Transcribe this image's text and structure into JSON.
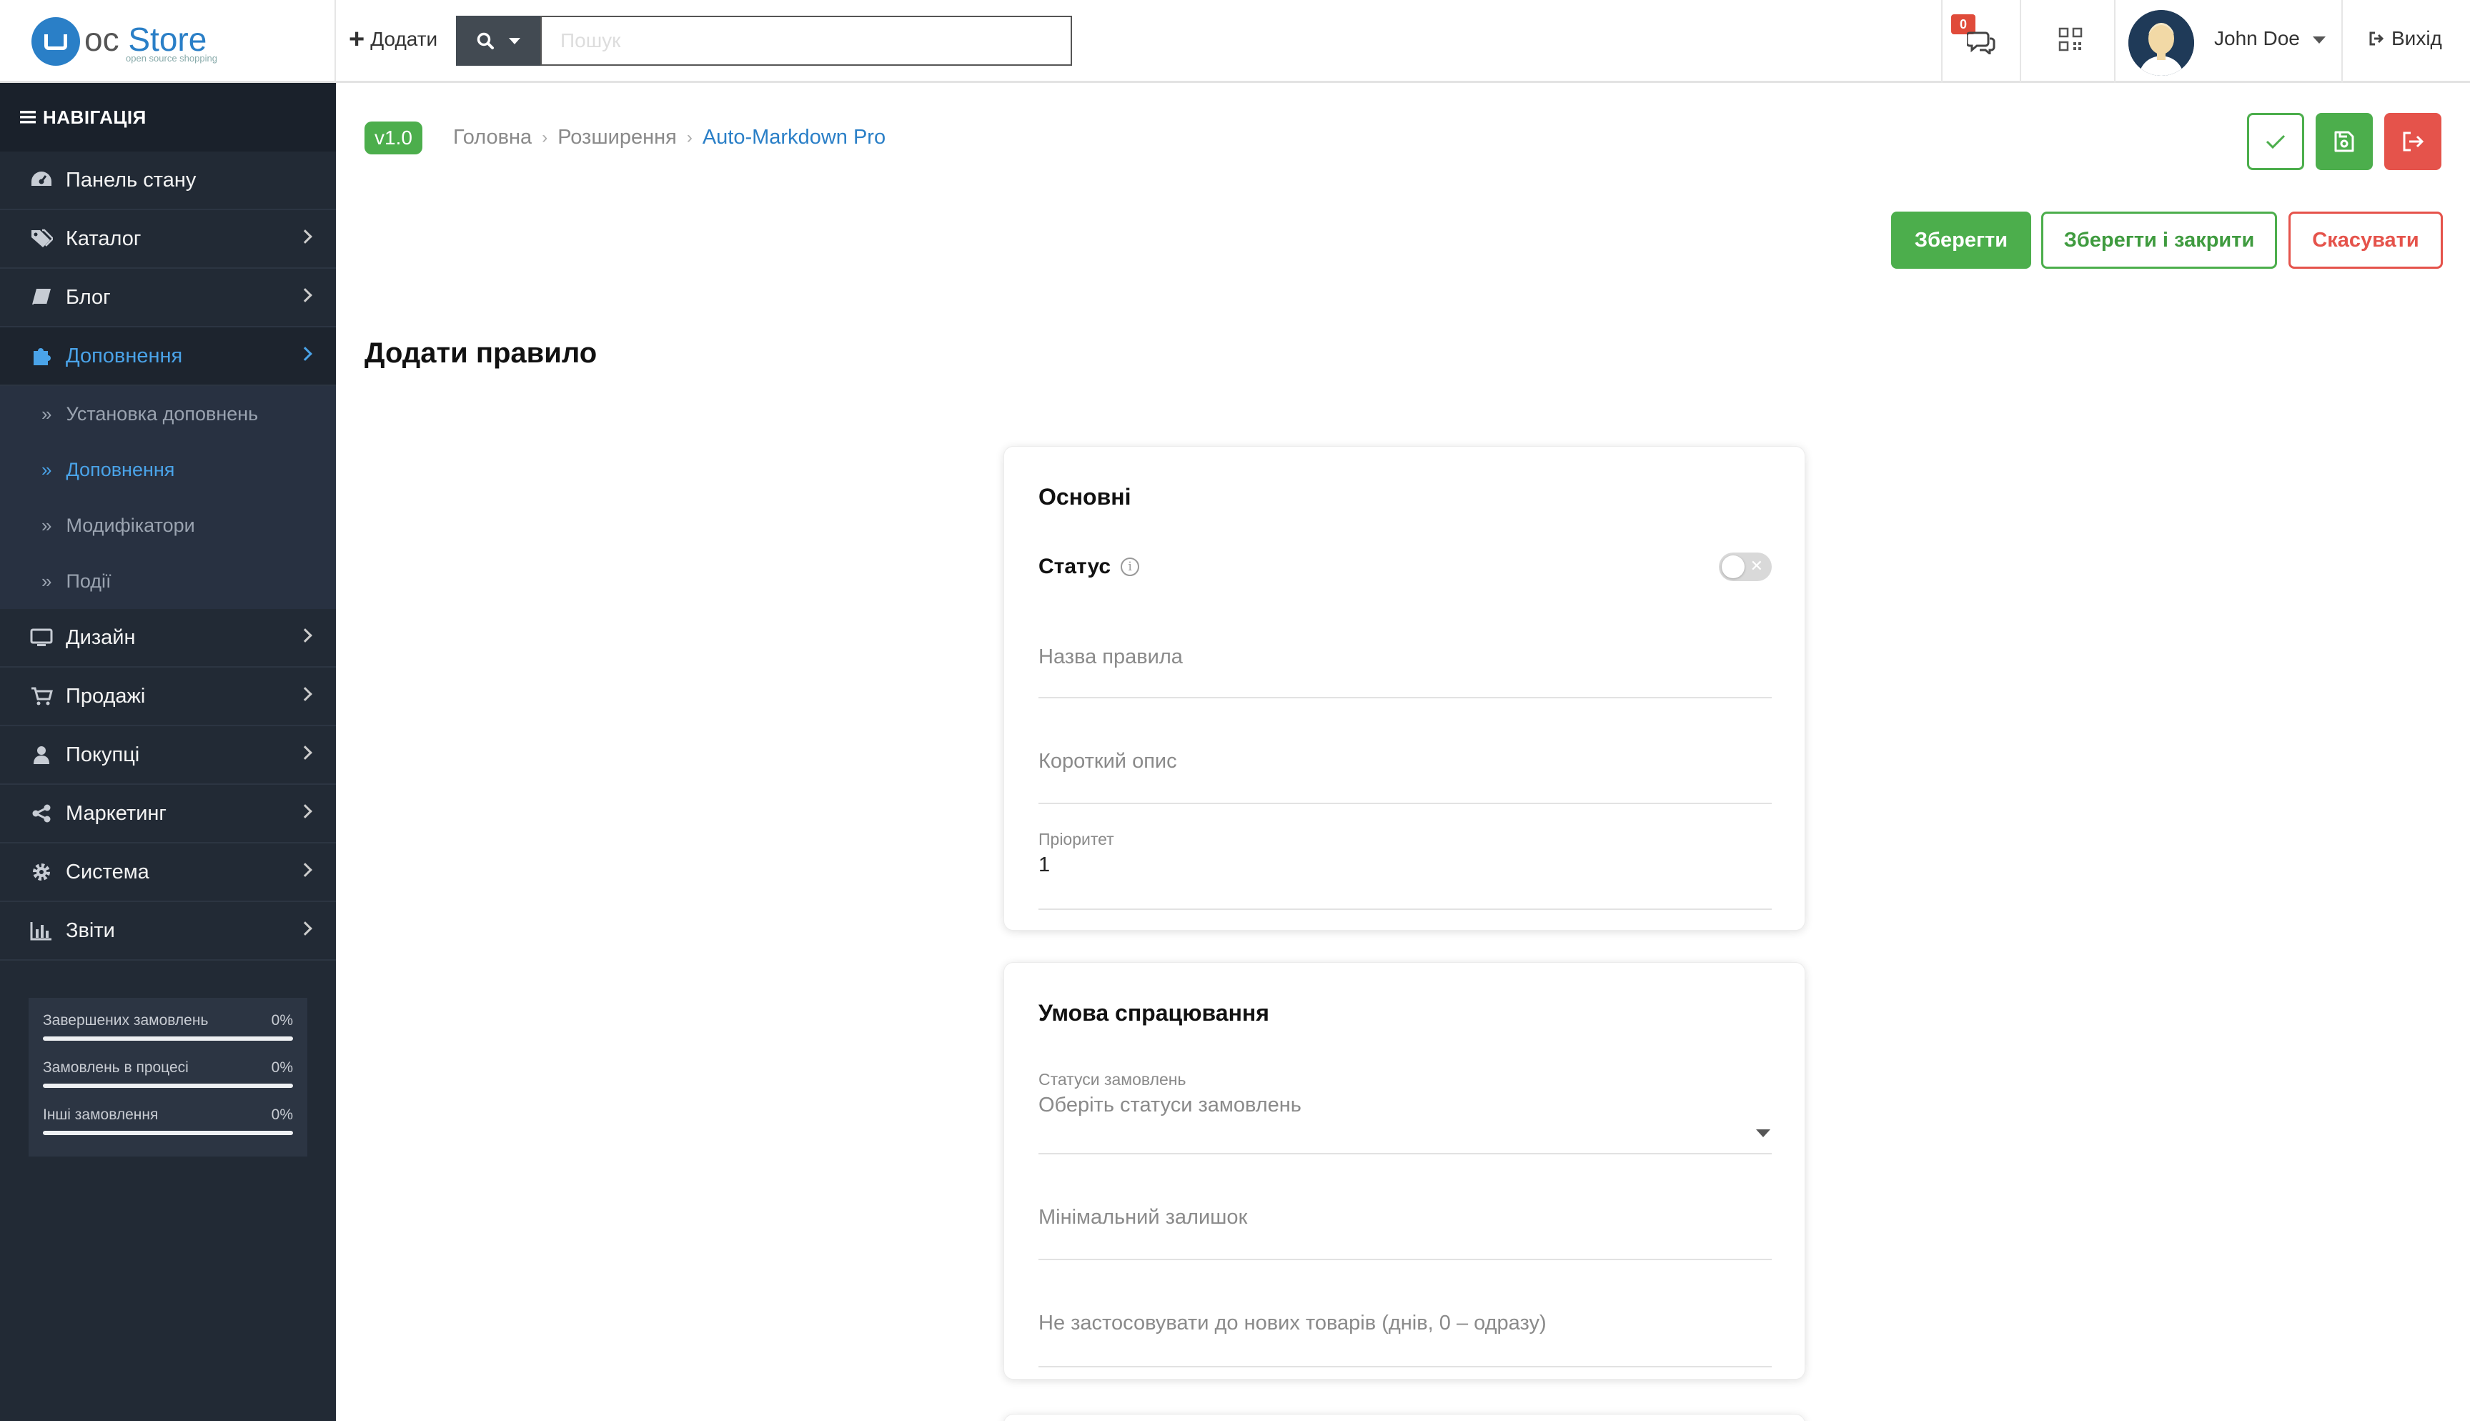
{
  "header": {
    "logo_text_oc": "oc",
    "logo_text_store": "Store",
    "logo_sub": "open source shopping",
    "add_label": "Додати",
    "search_placeholder": "Пошук",
    "notification_count": "0",
    "user_name": "John Doe",
    "logout_label": "Вихід"
  },
  "sidebar": {
    "nav_title": "НАВІГАЦІЯ",
    "items": [
      {
        "label": "Панель стану",
        "icon": "dashboard-icon"
      },
      {
        "label": "Каталог",
        "icon": "tags-icon"
      },
      {
        "label": "Блог",
        "icon": "book-icon"
      },
      {
        "label": "Доповнення",
        "icon": "puzzle-icon",
        "active": true
      },
      {
        "label": "Дизайн",
        "icon": "monitor-icon"
      },
      {
        "label": "Продажі",
        "icon": "cart-icon"
      },
      {
        "label": "Покупці",
        "icon": "user-icon"
      },
      {
        "label": "Маркетинг",
        "icon": "share-icon"
      },
      {
        "label": "Система",
        "icon": "gear-icon"
      },
      {
        "label": "Звіти",
        "icon": "bar-chart-icon"
      }
    ],
    "sub_items": [
      {
        "label": "Установка доповнень"
      },
      {
        "label": "Доповнення",
        "active": true
      },
      {
        "label": "Модифікатори"
      },
      {
        "label": "Події"
      }
    ],
    "stats": [
      {
        "label": "Завершених замовлень",
        "value": "0%",
        "fill": 0
      },
      {
        "label": "Замовлень в процесі",
        "value": "0%",
        "fill": 0
      },
      {
        "label": "Інші замовлення",
        "value": "0%",
        "fill": 0
      }
    ]
  },
  "main": {
    "version": "v1.0",
    "breadcrumb": [
      "Головна",
      "Розширення",
      "Auto-Markdown Pro"
    ],
    "buttons": {
      "save": "Зберегти",
      "save_close": "Зберегти і закрити",
      "cancel": "Скасувати"
    },
    "page_title": "Додати правило",
    "card_basic": {
      "title": "Основні",
      "status_label": "Статус",
      "status_on": false,
      "rule_name_placeholder": "Назва правила",
      "short_desc_placeholder": "Короткий опис",
      "priority_label": "Пріоритет",
      "priority_value": "1"
    },
    "card_trigger": {
      "title": "Умова спрацювання",
      "order_status_label": "Статуси замовлень",
      "order_status_placeholder": "Оберіть статуси замовлень",
      "min_stock_placeholder": "Мінімальний залишок",
      "new_products_placeholder": "Не застосовувати до нових товарів (днів, 0 – одразу)"
    }
  },
  "colors": {
    "accent_green": "#4cae4c",
    "accent_red": "#e5534b",
    "link_blue": "#2a7fc7",
    "sidebar_bg": "#222a35"
  }
}
